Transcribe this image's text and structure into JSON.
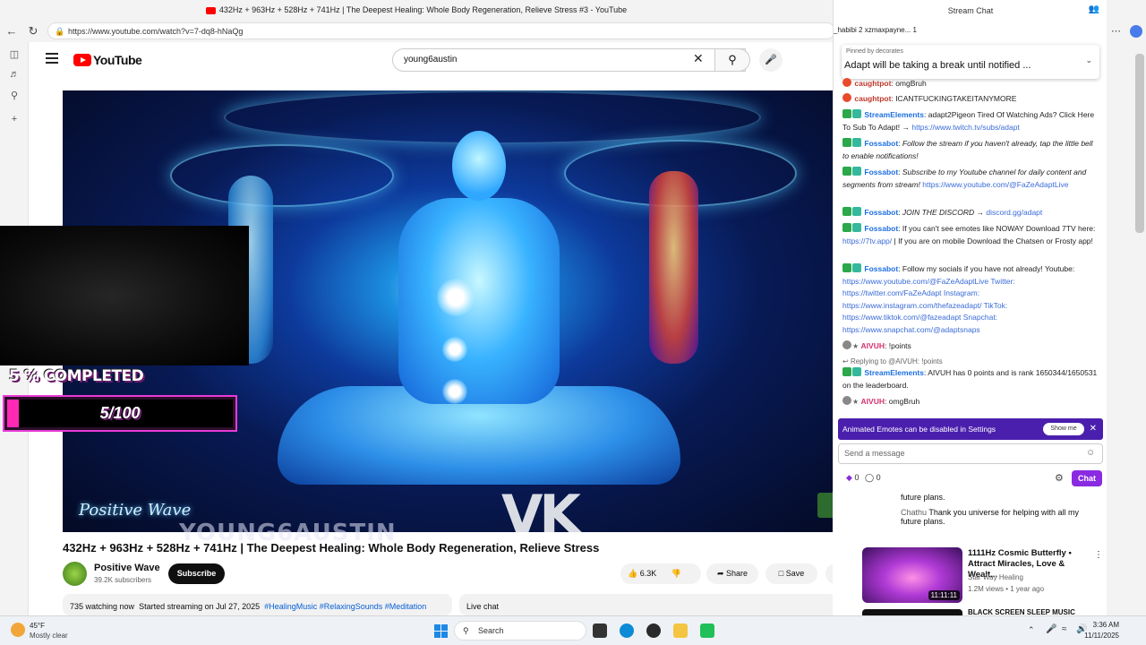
{
  "browser": {
    "tab_title": "432Hz + 963Hz + 528Hz + 741Hz | The Deepest Healing: Whole Body Regeneration, Relieve Stress #3 - YouTube",
    "url": "https://www.youtube.com/watch?v=7-dq8-hNaQg"
  },
  "youtube": {
    "logo_text": "YouTube",
    "search_query": "young6austin",
    "video": {
      "brand_watermark": "Positive Wave",
      "title": "432Hz + 963Hz + 528Hz + 741Hz | The Deepest Healing: Whole Body Regeneration, Relieve Stress",
      "channel_name": "Positive Wave",
      "subscribers": "39.2K subscribers",
      "subscribe_label": "Subscribe",
      "likes": "6.3K",
      "share_label": "Share",
      "save_label": "Save",
      "watching": "735 watching now",
      "started": "Started streaming on Jul 27, 2025",
      "tags": "#HealingMusic #RelaxingSounds #Meditation",
      "live_chat_label": "Live chat"
    },
    "live_chat_preview": [
      {
        "text": "future plans."
      },
      {
        "user": "Chathu",
        "text": "Thank you universe for helping with all my future plans."
      }
    ],
    "recommendation": {
      "title": "1111Hz Cosmic Butterfly • Attract Miracles, Love & Wealt...",
      "channel": "Star Way Healing",
      "meta": "1.2M views • 1 year ago",
      "duration": "11:11:11",
      "next_title": "BLACK SCREEN SLEEP MUSIC"
    }
  },
  "overlay": {
    "goal_label": "5 % COMPLETED",
    "goal_count": "5/100",
    "goal_progress": 0.05,
    "vk_text": "VK",
    "name_text": "YOUNG6AUSTIN"
  },
  "stream_chat": {
    "header": "Stream Chat",
    "viewer_row": "_habibi  2  xzmaxpayne...  1",
    "pinned_by": "Pinned by decorates",
    "pinned_text": "Adapt will be taking a break until notified ...",
    "messages": [
      {
        "user": "caughtpot",
        "text": "omgBruh"
      },
      {
        "user": "caughtpot",
        "text": "ICANTFUCKINGTAKEITANYMORE"
      },
      {
        "user": "StreamElements",
        "text": "adapt2Pigeon Tired Of Watching Ads? Click Here To Sub To Adapt! →",
        "link": "https://www.twitch.tv/subs/adapt"
      },
      {
        "user": "Fossabot",
        "text": "Follow the stream if you haven't already, tap the little bell to enable notifications!"
      },
      {
        "user": "Fossabot",
        "text": "Subscribe to my Youtube channel for daily content and segments from stream!",
        "link": "https://www.youtube.com/@FaZeAdaptLive"
      },
      {
        "user": "Fossabot",
        "text": "JOIN THE DISCORD →",
        "link": "discord.gg/adapt"
      },
      {
        "user": "Fossabot",
        "text": "If you can't see emotes like NOWAY Download 7TV here:",
        "link": "https://7tv.app/",
        "text2": "| If you are on mobile Download the Chatsen or Frosty app!"
      },
      {
        "user": "Fossabot",
        "text": "Follow my socials if you have not already! Youtube:",
        "links": "https://www.youtube.com/@FaZeAdaptLive Twitter: https://twitter.com/FaZeAdapt Instagram: https://www.instagram.com/thefazeadapt/ TikTok: https://www.tiktok.com/@fazeadapt Snapchat: https://www.snapchat.com/@adaptsnaps"
      },
      {
        "user": "AIVUH",
        "text": "!points"
      },
      {
        "reply_to": "Replying to @AIVUH: !points"
      },
      {
        "user": "StreamElements",
        "text": "AIVUH has 0 points and is rank 1650344/1650531 on the leaderboard."
      },
      {
        "user": "AIVUH",
        "text": "omgBruh"
      }
    ],
    "emote_notice": "Animated Emotes can be disabled in Settings",
    "show_me_label": "Show me",
    "input_placeholder": "Send a message",
    "points_a": "0",
    "points_b": "0",
    "chat_button": "Chat"
  },
  "taskbar": {
    "temperature": "45°F",
    "weather": "Mostly clear",
    "search_label": "Search",
    "time": "3:36 AM",
    "date": "11/11/2025"
  },
  "colors": {
    "youtube_red": "#ff0000",
    "twitch_purple": "#8a2be2",
    "goal_pink": "#ff29b6",
    "link_blue": "#065fd4"
  }
}
